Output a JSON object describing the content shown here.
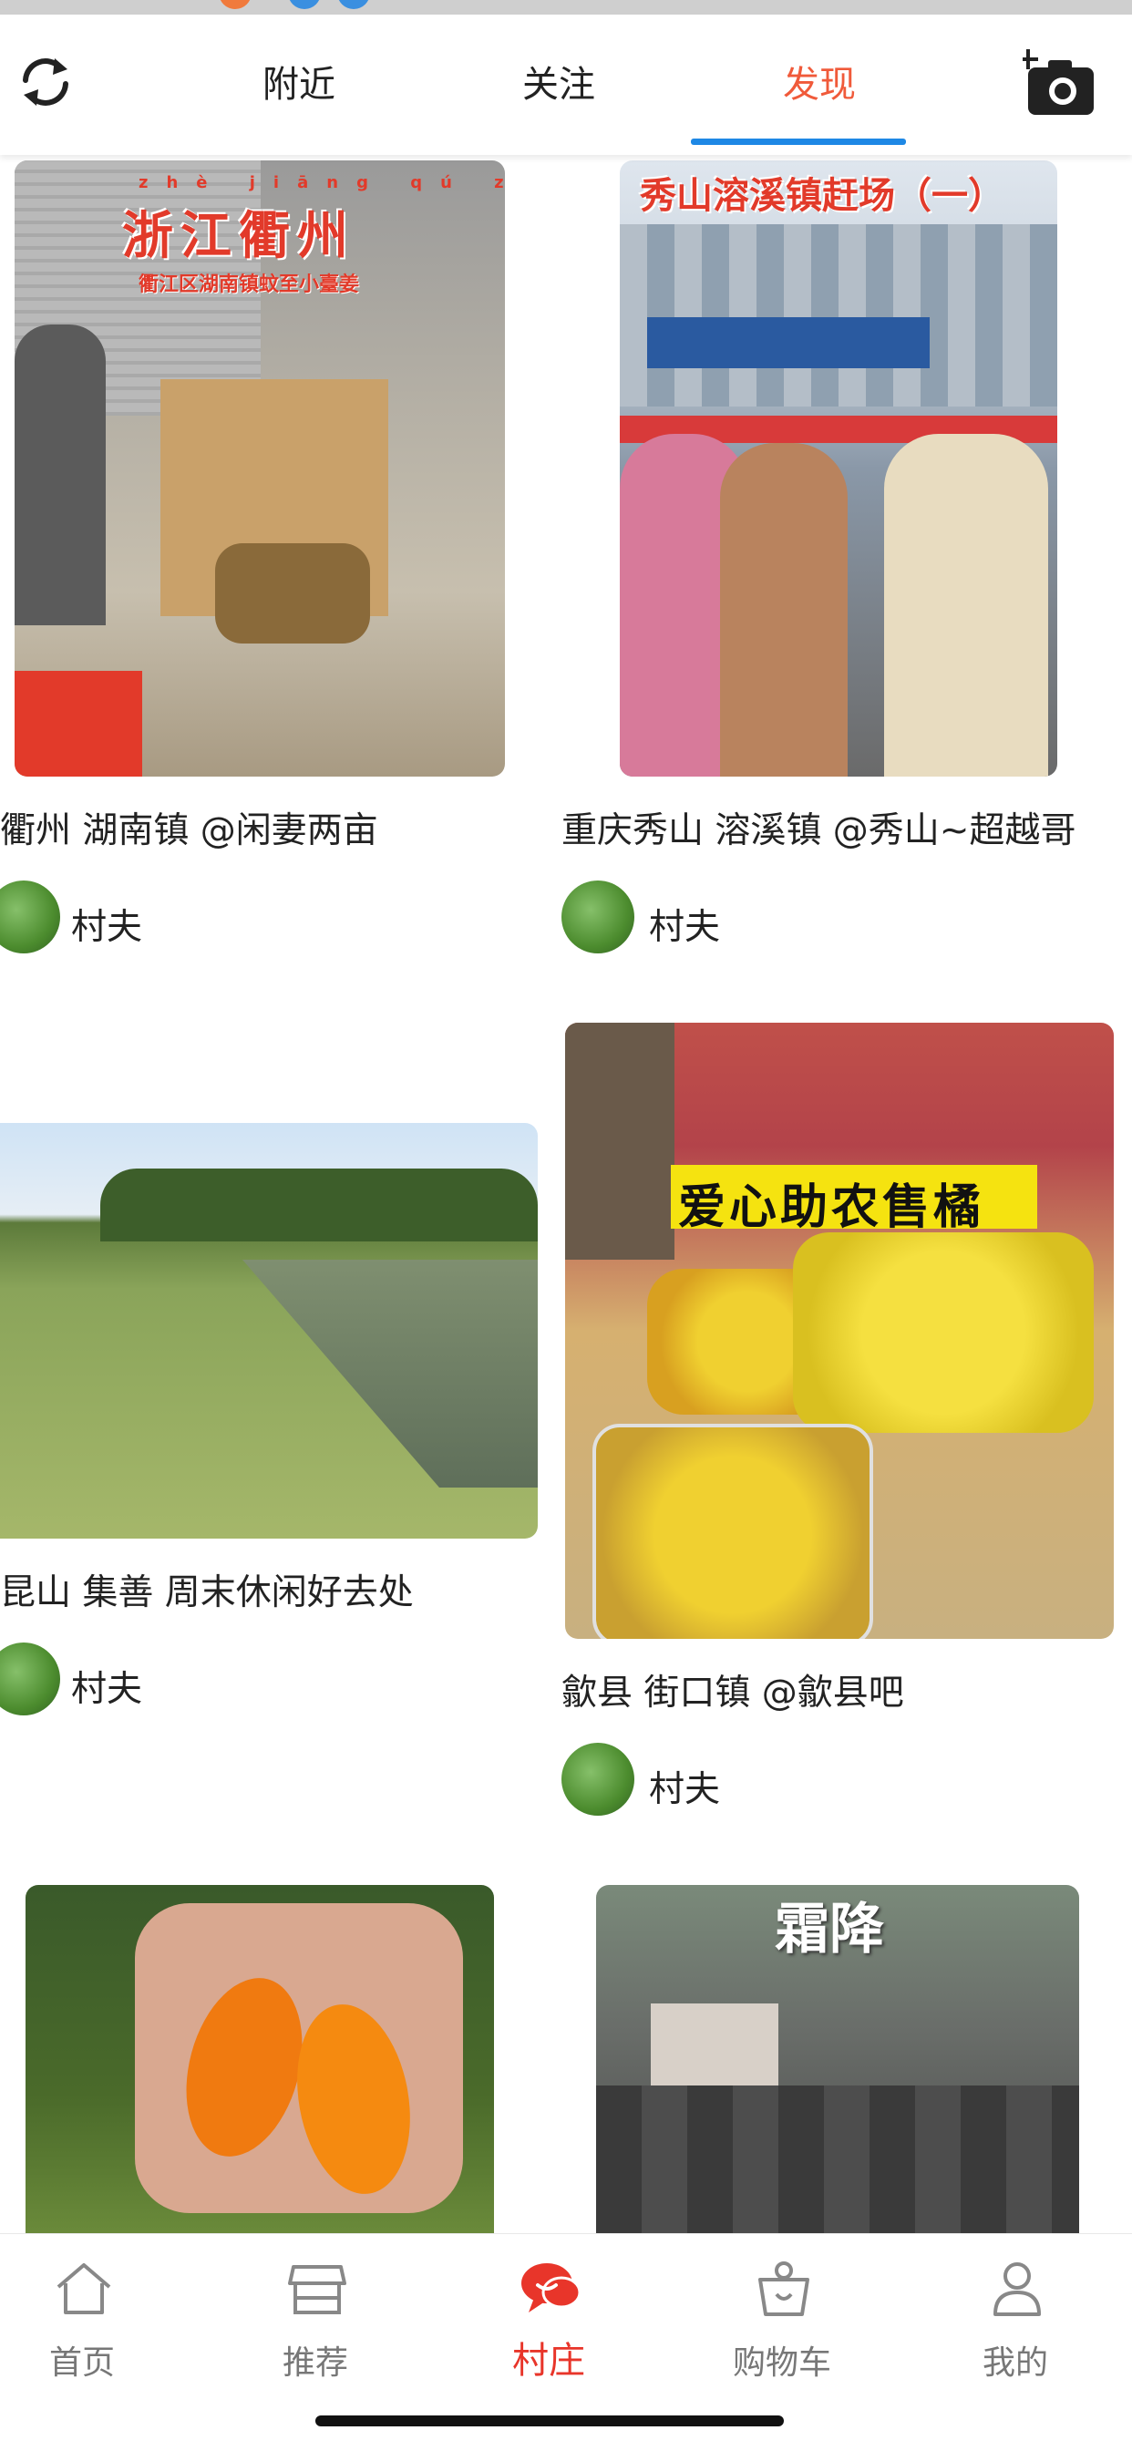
{
  "top_nav": {
    "tabs": [
      {
        "label": "附近"
      },
      {
        "label": "关注"
      },
      {
        "label": "发现"
      }
    ],
    "active_tab": "发现"
  },
  "feed": [
    {
      "overlay": "浙江衢州",
      "overlay_pinyin": "zhè jiāng qú zhōu",
      "overlay_sub": "衢江区湖南镇蚊至小臺姜",
      "title": "衢州 湖南镇 @闲妻两亩",
      "author": "村夫"
    },
    {
      "overlay": "秀山溶溪镇赶场（一）",
      "title": "重庆秀山 溶溪镇 @秀山~超越哥",
      "author": "村夫"
    },
    {
      "title": "昆山 集善  周末休闲好去处",
      "author": "村夫"
    },
    {
      "overlay": "爱心助农售橘",
      "title": "歙县 街口镇 @歙县吧",
      "author": "村夫"
    },
    {
      "title": "",
      "author": ""
    },
    {
      "overlay": "霜降",
      "title": "",
      "author": ""
    }
  ],
  "bottom_nav": {
    "items": [
      {
        "label": "首页",
        "icon": "home-icon"
      },
      {
        "label": "推荐",
        "icon": "store-icon"
      },
      {
        "label": "村庄",
        "icon": "chat-bubble-icon"
      },
      {
        "label": "购物车",
        "icon": "shopping-bag-icon"
      },
      {
        "label": "我的",
        "icon": "user-icon"
      }
    ],
    "active": "村庄"
  },
  "colors": {
    "active_tab": "#f05a3a",
    "tab_underline": "#1e88e5",
    "bottom_active": "#e8352a",
    "inactive_icon": "#777777"
  }
}
